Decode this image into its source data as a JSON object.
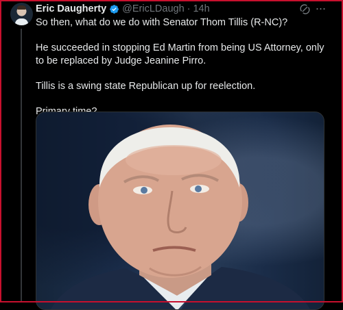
{
  "tweet": {
    "author_name": "Eric Daugherty",
    "handle": "@EricLDaugh",
    "separator": "·",
    "time": "14h",
    "paragraphs": [
      "So then, what do we do with Senator Thom Tillis (R-NC)?",
      "He succeeded in stopping Ed Martin from being US Attorney, only to be replaced by Judge Jeanine Pirro.",
      "Tillis is a swing state Republican up for reelection.",
      "Primary time?"
    ],
    "more_label": "···"
  },
  "icons": {
    "verified": "verified-badge-icon",
    "grok": "grok-icon",
    "more": "more-icon"
  },
  "colors": {
    "background": "#000000",
    "text": "#e7e9ea",
    "muted": "#71767b",
    "verified": "#1d9bf0",
    "frame": "#c8102e"
  }
}
